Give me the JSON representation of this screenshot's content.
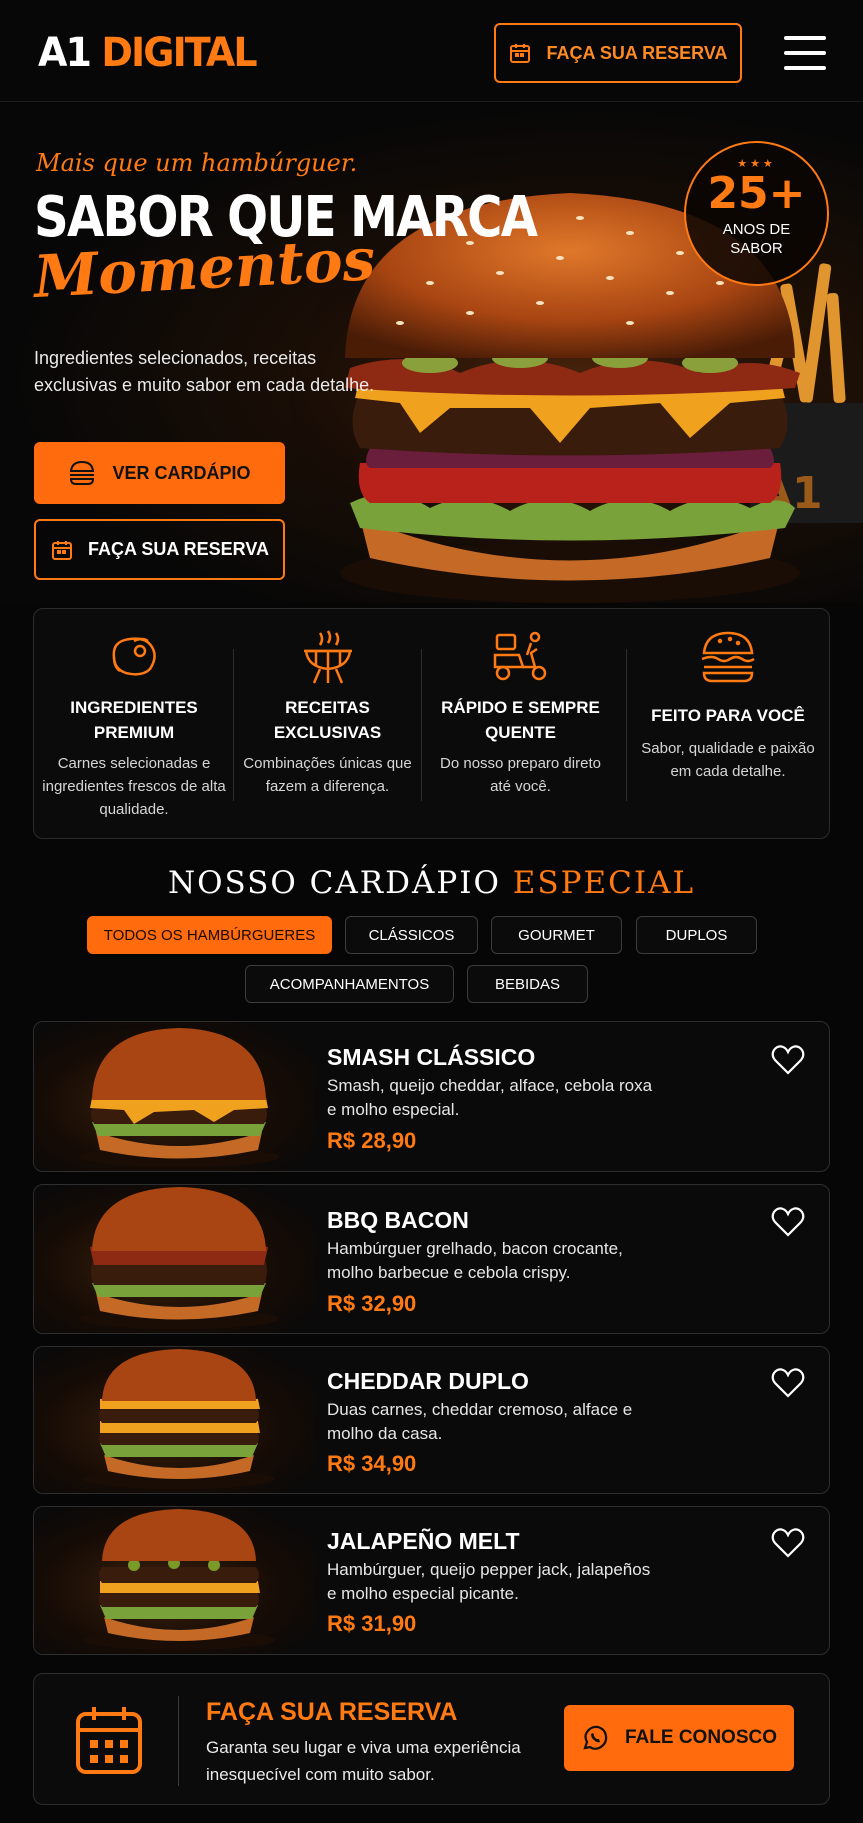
{
  "header": {
    "logo_a1": "A1",
    "logo_digital": "DIGITAL",
    "reserve_label": "FAÇA SUA RESERVA"
  },
  "hero": {
    "tagline": "Mais que um hambúrguer.",
    "title": "SABOR QUE MARCA",
    "title_script": "Momentos",
    "description": "Ingredientes selecionados, receitas exclusivas e muito sabor em cada detalhe.",
    "menu_button": "VER CARDÁPIO",
    "reserve_button": "FAÇA SUA RESERVA",
    "badge": {
      "stars": "★★★",
      "number": "25+",
      "line1": "ANOS DE",
      "line2": "SABOR"
    }
  },
  "features": [
    {
      "title": "INGREDIENTES PREMIUM",
      "text": "Carnes selecionadas e ingredientes frescos de alta qualidade.",
      "icon": "steak-icon"
    },
    {
      "title": "RECEITAS EXCLUSIVAS",
      "text": "Combinações únicas que fazem a diferença.",
      "icon": "grill-icon"
    },
    {
      "title": "RÁPIDO E SEMPRE QUENTE",
      "text": "Do nosso preparo direto até você.",
      "icon": "delivery-scooter-icon"
    },
    {
      "title": "FEITO PARA VOCÊ",
      "text": "Sabor, qualidade e paixão em cada detalhe.",
      "icon": "burger-icon"
    }
  ],
  "menu": {
    "title_white": "NOSSO CARDÁPIO",
    "title_orange": "ESPECIAL",
    "categories": [
      "TODOS OS HAMBÚRGUERES",
      "CLÁSSICOS",
      "GOURMET",
      "DUPLOS",
      "ACOMPANHAMENTOS",
      "BEBIDAS"
    ],
    "items": [
      {
        "name": "SMASH CLÁSSICO",
        "description": "Smash, queijo cheddar, alface, cebola roxa e molho especial.",
        "price": "R$ 28,90"
      },
      {
        "name": "BBQ BACON",
        "description": "Hambúrguer grelhado, bacon crocante, molho barbecue e cebola crispy.",
        "price": "R$ 32,90"
      },
      {
        "name": "CHEDDAR DUPLO",
        "description": "Duas carnes, cheddar cremoso, alface e molho da casa.",
        "price": "R$ 34,90"
      },
      {
        "name": "JALAPEÑO MELT",
        "description": "Hambúrguer, queijo pepper jack, jalapeños e molho especial picante.",
        "price": "R$ 31,90"
      }
    ]
  },
  "reservation": {
    "title": "FAÇA SUA RESERVA",
    "description": "Garanta seu lugar e viva uma experiência inesquecível com muito sabor.",
    "button": "FALE CONOSCO"
  },
  "colors": {
    "accent": "#ff7a12",
    "background": "#060606"
  }
}
